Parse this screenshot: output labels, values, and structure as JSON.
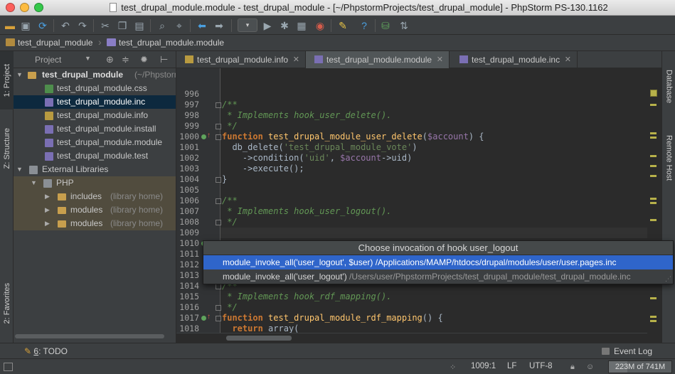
{
  "window": {
    "title": "test_drupal_module.module - test_drupal_module - [~/PhpstormProjects/test_drupal_module] - PhpStorm PS-130.1162"
  },
  "toolbar": {
    "icons": [
      "open-folder-icon",
      "save-icon",
      "sync-icon",
      "undo-icon",
      "redo-icon",
      "cut-icon",
      "copy-icon",
      "paste-icon",
      "find-icon",
      "replace-icon",
      "back-icon",
      "forward-icon",
      "run-config-dropdown",
      "run-icon",
      "debug-icon",
      "coverage-icon",
      "stop-icon",
      "settings-icon",
      "sdk-icon",
      "help-icon",
      "db-icon",
      "remote-icon"
    ],
    "run_config_label": "▾"
  },
  "breadcrumb": {
    "items": [
      "test_drupal_module",
      "test_drupal_module.module"
    ]
  },
  "left_strip": {
    "tabs": [
      "1: Project",
      "Z: Structure",
      "2: Favorites"
    ]
  },
  "right_strip": {
    "tabs": [
      "Database",
      "Remote Host"
    ]
  },
  "project": {
    "header_label": "Project",
    "root_name": "test_drupal_module",
    "root_path": "(~/Phpstorm",
    "files": [
      {
        "name": "test_drupal_module.css",
        "type": "css"
      },
      {
        "name": "test_drupal_module.inc",
        "type": "php",
        "selected": true
      },
      {
        "name": "test_drupal_module.info",
        "type": "info"
      },
      {
        "name": "test_drupal_module.install",
        "type": "php"
      },
      {
        "name": "test_drupal_module.module",
        "type": "php"
      },
      {
        "name": "test_drupal_module.test",
        "type": "php"
      }
    ],
    "external_libraries": "External Libraries",
    "php_label": "PHP",
    "libs": [
      {
        "name": "includes",
        "hint": "(library home)"
      },
      {
        "name": "modules",
        "hint": "(library home)"
      },
      {
        "name": "modules",
        "hint": "(library home)"
      }
    ]
  },
  "editor_tabs": [
    {
      "label": "test_drupal_module.info",
      "active": false
    },
    {
      "label": "test_drupal_module.module",
      "active": true
    },
    {
      "label": "test_drupal_module.inc",
      "active": false
    }
  ],
  "editor": {
    "line_numbers": [
      "996",
      "997",
      "998",
      "999",
      "1000",
      "1001",
      "1002",
      "1003",
      "1004",
      "1005",
      "1006",
      "1007",
      "1008",
      "1009",
      "1010",
      "1011",
      "1012",
      "1013",
      "1014",
      "1015",
      "1016",
      "1017",
      "1018"
    ]
  },
  "popup": {
    "title": "Choose invocation of hook user_logout",
    "items": [
      {
        "call": "module_invoke_all('user_logout', $user)",
        "path": "/Applications/MAMP/htdocs/drupal/modules/user/user.pages.inc",
        "selected": true
      },
      {
        "call": "module_invoke_all('user_logout')",
        "path": "/Users/user/PhpstormProjects/test_drupal_module/test_drupal_module.inc",
        "selected": false
      }
    ]
  },
  "bottom": {
    "todo_num": "6",
    "todo_label": ": TODO",
    "event_log": "Event Log"
  },
  "status": {
    "position": "1009:1",
    "line_sep": "LF",
    "encoding": "UTF-8",
    "memory": "223M of 741M",
    "memory_fraction": 0.3
  },
  "colors": {
    "selection": "#2f65ca",
    "tree_selection": "#0d293e",
    "comment": "#629755",
    "keyword": "#cc7832",
    "function": "#ffc66d",
    "string": "#6a8759",
    "variable": "#9876aa"
  }
}
